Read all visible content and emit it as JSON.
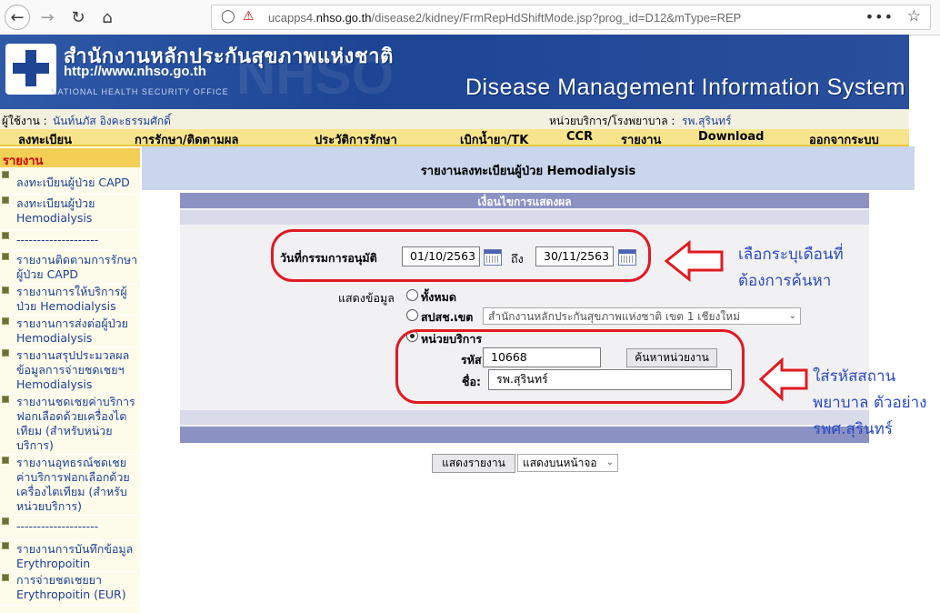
{
  "browser": {
    "url_prefix": "ucapps4.",
    "url_host": "nhso.go.th",
    "url_path": "/disease2/kidney/FrmRepHdShiftMode.jsp?prog_id=D12&mType=REP"
  },
  "banner": {
    "org_thai": "สำนักงานหลักประกันสุขภาพแห่งชาติ",
    "org_url": "http://www.nhso.go.th",
    "org_eng": "NATIONAL HEALTH SECURITY OFFICE",
    "system_title": "Disease Management Information System"
  },
  "user": {
    "label": "ผู้ใช้งาน :",
    "name": "นันท์นภัส อิงคะธรรมศักดิ์",
    "unit_label": "หน่วยบริการ/โรงพยาบาล :",
    "unit_name": "รพ.สุรินทร์"
  },
  "menu": [
    "ลงทะเบียน",
    "การรักษา/ติดตามผล",
    "ประวัติการรักษา",
    "เบิกน้ำยา/TK",
    "CCR",
    "รายงาน",
    "Download",
    "ออกจากระบบ"
  ],
  "sidebar": {
    "header": "รายงาน",
    "items": [
      "ลงทะเบียนผู้ป่วย CAPD",
      "ลงทะเบียนผู้ป่วย Hemodialysis",
      "--------------------",
      "รายงานติดตามการรักษาผู้ป่วย CAPD",
      "รายงานการให้บริการผู้ป่วย Hemodialysis",
      "รายงานการส่งต่อผู้ป่วย Hemodialysis",
      "รายงานสรุปประมวลผลข้อมูลการจ่ายชดเชยฯ Hemodialysis",
      "รายงานชดเชยค่าบริการฟอกเลือดด้วยเครื่องไตเทียม (สำหรับหน่วยบริการ)",
      "รายงานอุทธรณ์ชดเชยค่าบริการฟอกเลือกด้วยเครื่องไตเทียม (สำหรับหน่วยบริการ)",
      "--------------------",
      "รายงานการบันทึกข้อมูล Erythropoitin",
      "การจ่ายชดเชยยา Erythropoitin (EUR)"
    ]
  },
  "page": {
    "title": "รายงานลงทะเบียนผู้ป่วย Hemodialysis",
    "panel_header": "เงื่อนไขการแสดงผล"
  },
  "form": {
    "date_label": "วันที่กรรมการอนุมัติ",
    "date_from": "01/10/2563",
    "to_label": "ถึง",
    "date_to": "30/11/2563",
    "show_label": "แสดงข้อมูล",
    "opt_all": "ทั้งหมด",
    "opt_region": "สปสช.เขต",
    "region_value": "สำนักงานหลักประกันสุขภาพแห่งชาติ เขต 1 เชียงใหม่",
    "opt_unit": "หน่วยบริการ",
    "code_label": "รหัส:",
    "code_value": "10668",
    "search_button": "ค้นหาหน่วยงาน",
    "name_label": "ชื่อ:",
    "name_value": "รพ.สุรินทร์",
    "show_report_button": "แสดงรายงาน",
    "output_select": "แสดงบนหน้าจอ"
  },
  "annotations": {
    "note1": [
      "เลือกระบุเดือนที่",
      "ต้องการค้นหา"
    ],
    "note2": [
      "ใส่รหัสสถาน",
      "พยาบาล ตัวอย่าง",
      "รพศ.สุรินทร์"
    ]
  }
}
